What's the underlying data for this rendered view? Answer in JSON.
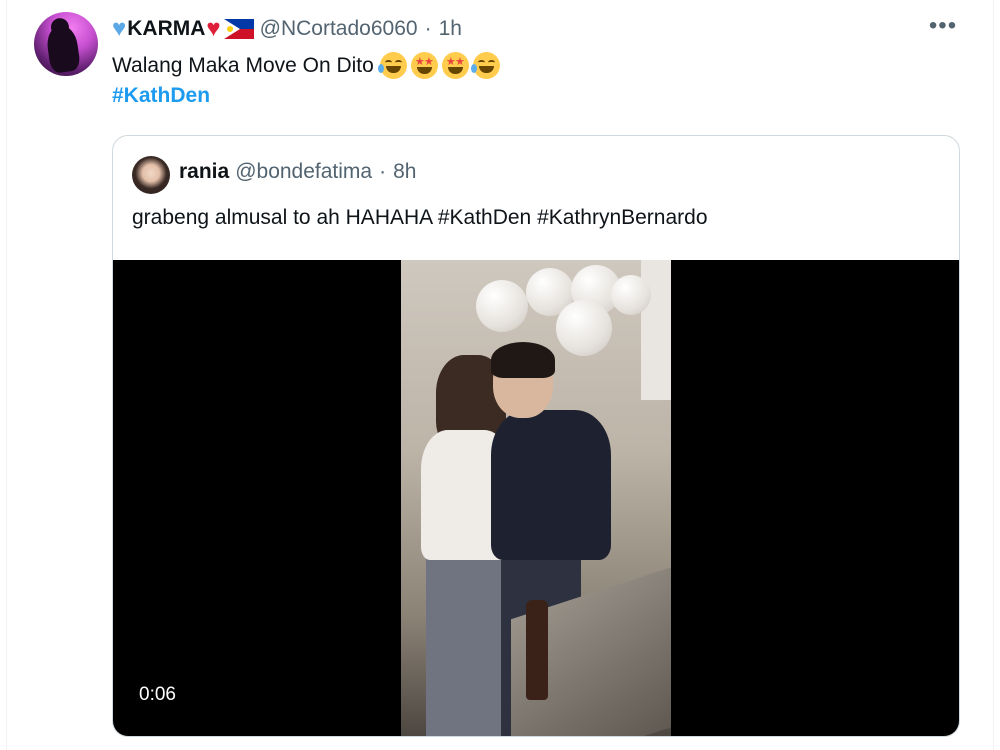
{
  "author": {
    "display_name": "KARMA",
    "handle": "@NCortado6060",
    "separator": "·",
    "time": "1h"
  },
  "tweet": {
    "text": "Walang Maka Move On Dito",
    "emojis": [
      "face-with-tears-of-joy",
      "star-struck",
      "star-struck",
      "face-with-tears-of-joy"
    ],
    "hashtag": "#KathDen"
  },
  "quoted": {
    "display_name": "rania",
    "handle": "@bondefatima",
    "separator": "·",
    "time": "8h",
    "text": "grabeng almusal to ah HAHAHA #KathDen #KathrynBernardo",
    "video": {
      "duration": "0:06"
    }
  },
  "colors": {
    "link": "#1d9bf0",
    "secondary_text": "#536471",
    "border": "#cfd9de",
    "heart_blue": "#5ba8e6",
    "heart_red": "#e0203a"
  }
}
